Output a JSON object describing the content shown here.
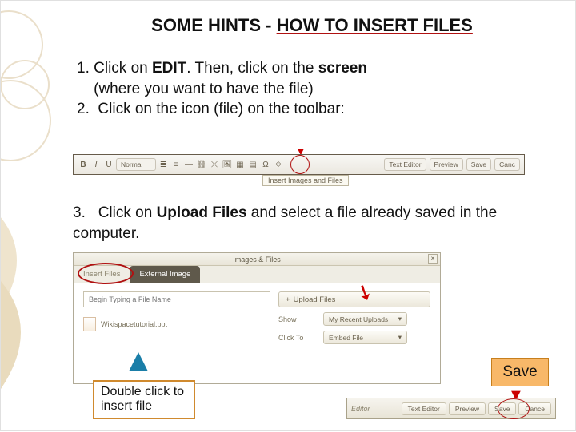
{
  "title_prefix": "SOME HINTS - ",
  "title_main": "HOW TO INSERT FILES",
  "step1": {
    "num": "1.",
    "a": "Click on ",
    "b_bold": "EDIT",
    "c": ". Then, click on the ",
    "d_bold": "screen",
    "e": " (where you want to have the file)",
    "num2": "2.",
    "f": "Click on the icon (file) on the toolbar:"
  },
  "toolbar1": {
    "bold": "B",
    "italic": "I",
    "underline": "U",
    "style_sel": "Normal",
    "texteditor": "Text Editor",
    "preview": "Preview",
    "save": "Save",
    "cancel": "Canc",
    "tooltip": "Insert Images and Files"
  },
  "step3": {
    "num": "3.",
    "a": "Click on ",
    "b_bold": "Upload Files",
    "c": "  and select a file already saved in the computer."
  },
  "dialog": {
    "title": "Images & Files",
    "tab_insert": "Insert Files",
    "tab_external": "External Image",
    "search_ph": "Begin Typing a File Name",
    "upload": "Upload Files",
    "file1": "Wikispacetutorial.ppt",
    "show": "Show",
    "show_val": "My Recent Uploads",
    "clickto": "Click To",
    "clickto_val": "Embed File"
  },
  "dblclick": "Double click to insert file",
  "save_label": "Save",
  "toolbar2": {
    "editor_lbl": "Editor",
    "texteditor": "Text Editor",
    "preview": "Preview",
    "save": "Save",
    "cancel": "Cance"
  }
}
